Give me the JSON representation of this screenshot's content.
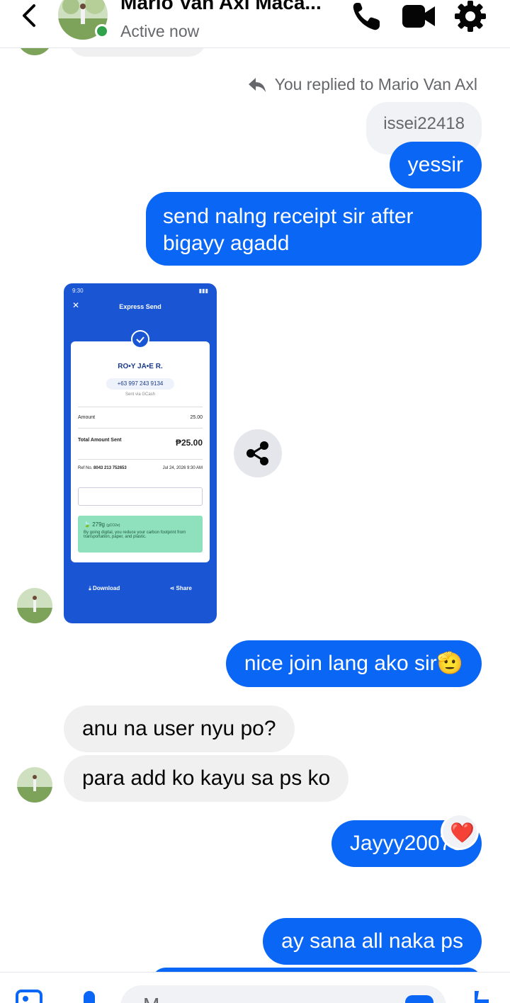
{
  "header": {
    "name": "Mario Van Axl Maca...",
    "status": "Active now"
  },
  "chat": {
    "reply_note": "You replied to Mario Van Axl",
    "quoted": "issei22418",
    "messages": [
      {
        "dir": "out",
        "text": "yessir"
      },
      {
        "dir": "out",
        "text": "send nalng receipt sir after bigayy agadd"
      },
      {
        "dir": "out",
        "text": "nice join lang ako sir"
      },
      {
        "dir": "in",
        "text": "anu na user nyu po?"
      },
      {
        "dir": "in",
        "text": "para add ko kayu sa ps ko"
      },
      {
        "dir": "out",
        "text": "Jayyy20073"
      },
      {
        "dir": "out",
        "text": "ay sana all naka ps"
      }
    ],
    "emoji": "🫡",
    "reaction": "❤️"
  },
  "receipt": {
    "time": "9:30",
    "title": "Express Send",
    "recipient": "RO•Y JA•E R.",
    "phone": "+63 997 243 9134",
    "sent_via": "Sent via GCash",
    "amount_label": "Amount",
    "amount": "25.00",
    "total_label": "Total Amount Sent",
    "total": "₱25.00",
    "ref_label": "Ref No.",
    "ref": "8043 213 752653",
    "date": "Jul 24, 2026 9:30 AM",
    "carbon": "279g",
    "carbon_unit": "(gCO2e)",
    "carbon_text": "By going digital, you reduce your carbon footprint from transportation, paper, and plastic.",
    "download": "Download",
    "share": "Share"
  },
  "composer": {
    "placeholder": "M"
  },
  "colors": {
    "outgoing": "#0a66f5",
    "incoming": "#f0f0f0",
    "online": "#31a24c"
  }
}
